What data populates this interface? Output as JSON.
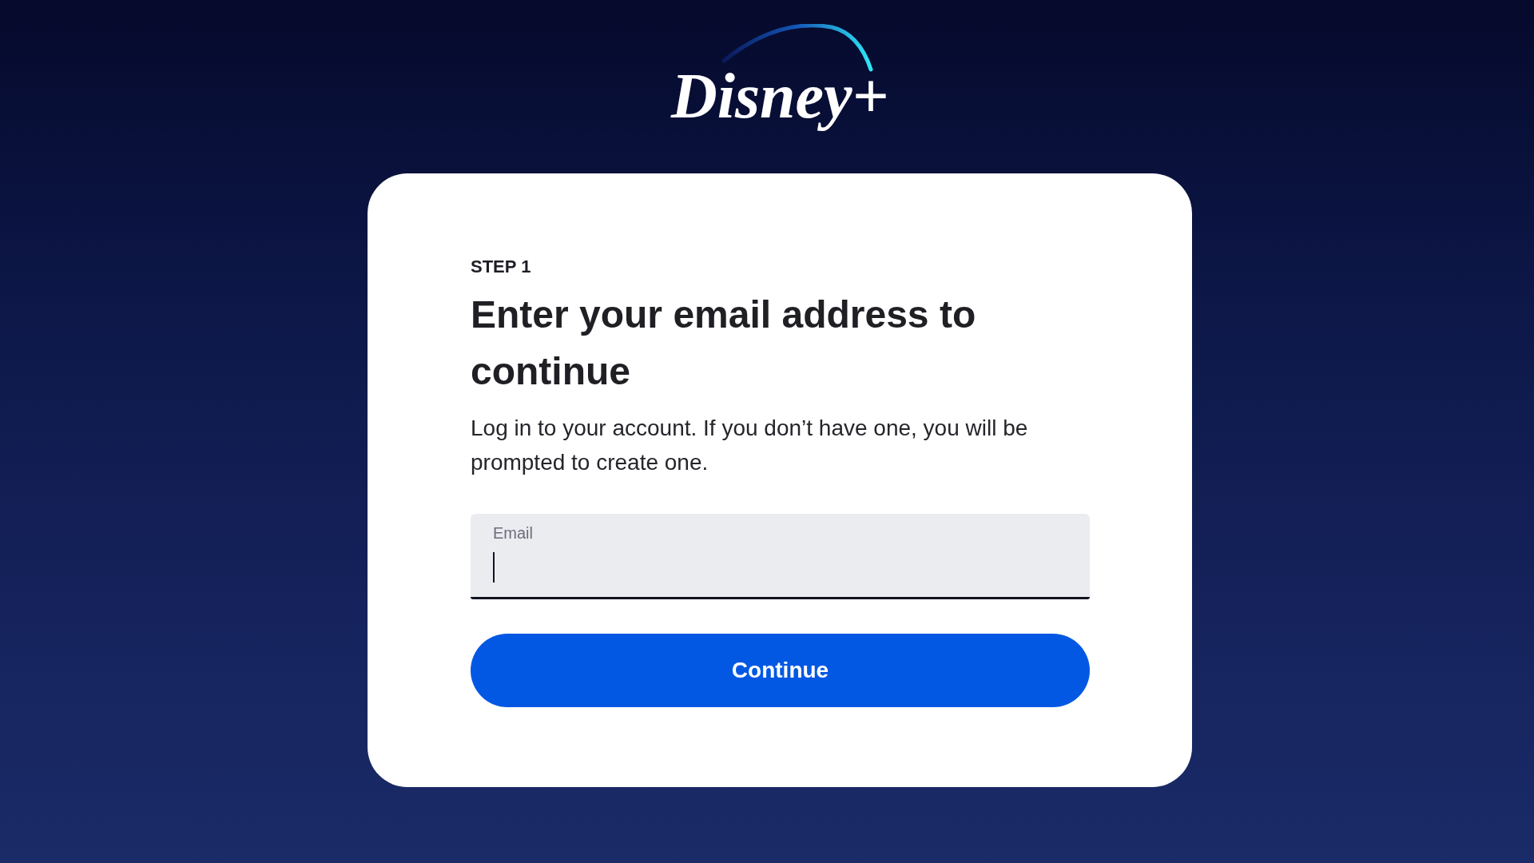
{
  "logo": {
    "text": "Disney+"
  },
  "card": {
    "step": "STEP 1",
    "heading": "Enter your email address to continue",
    "description": "Log in to your account. If you don’t have one, you will be prompted to create one.",
    "email_field": {
      "label": "Email",
      "focused": true
    },
    "button": {
      "label": "Continue"
    }
  }
}
